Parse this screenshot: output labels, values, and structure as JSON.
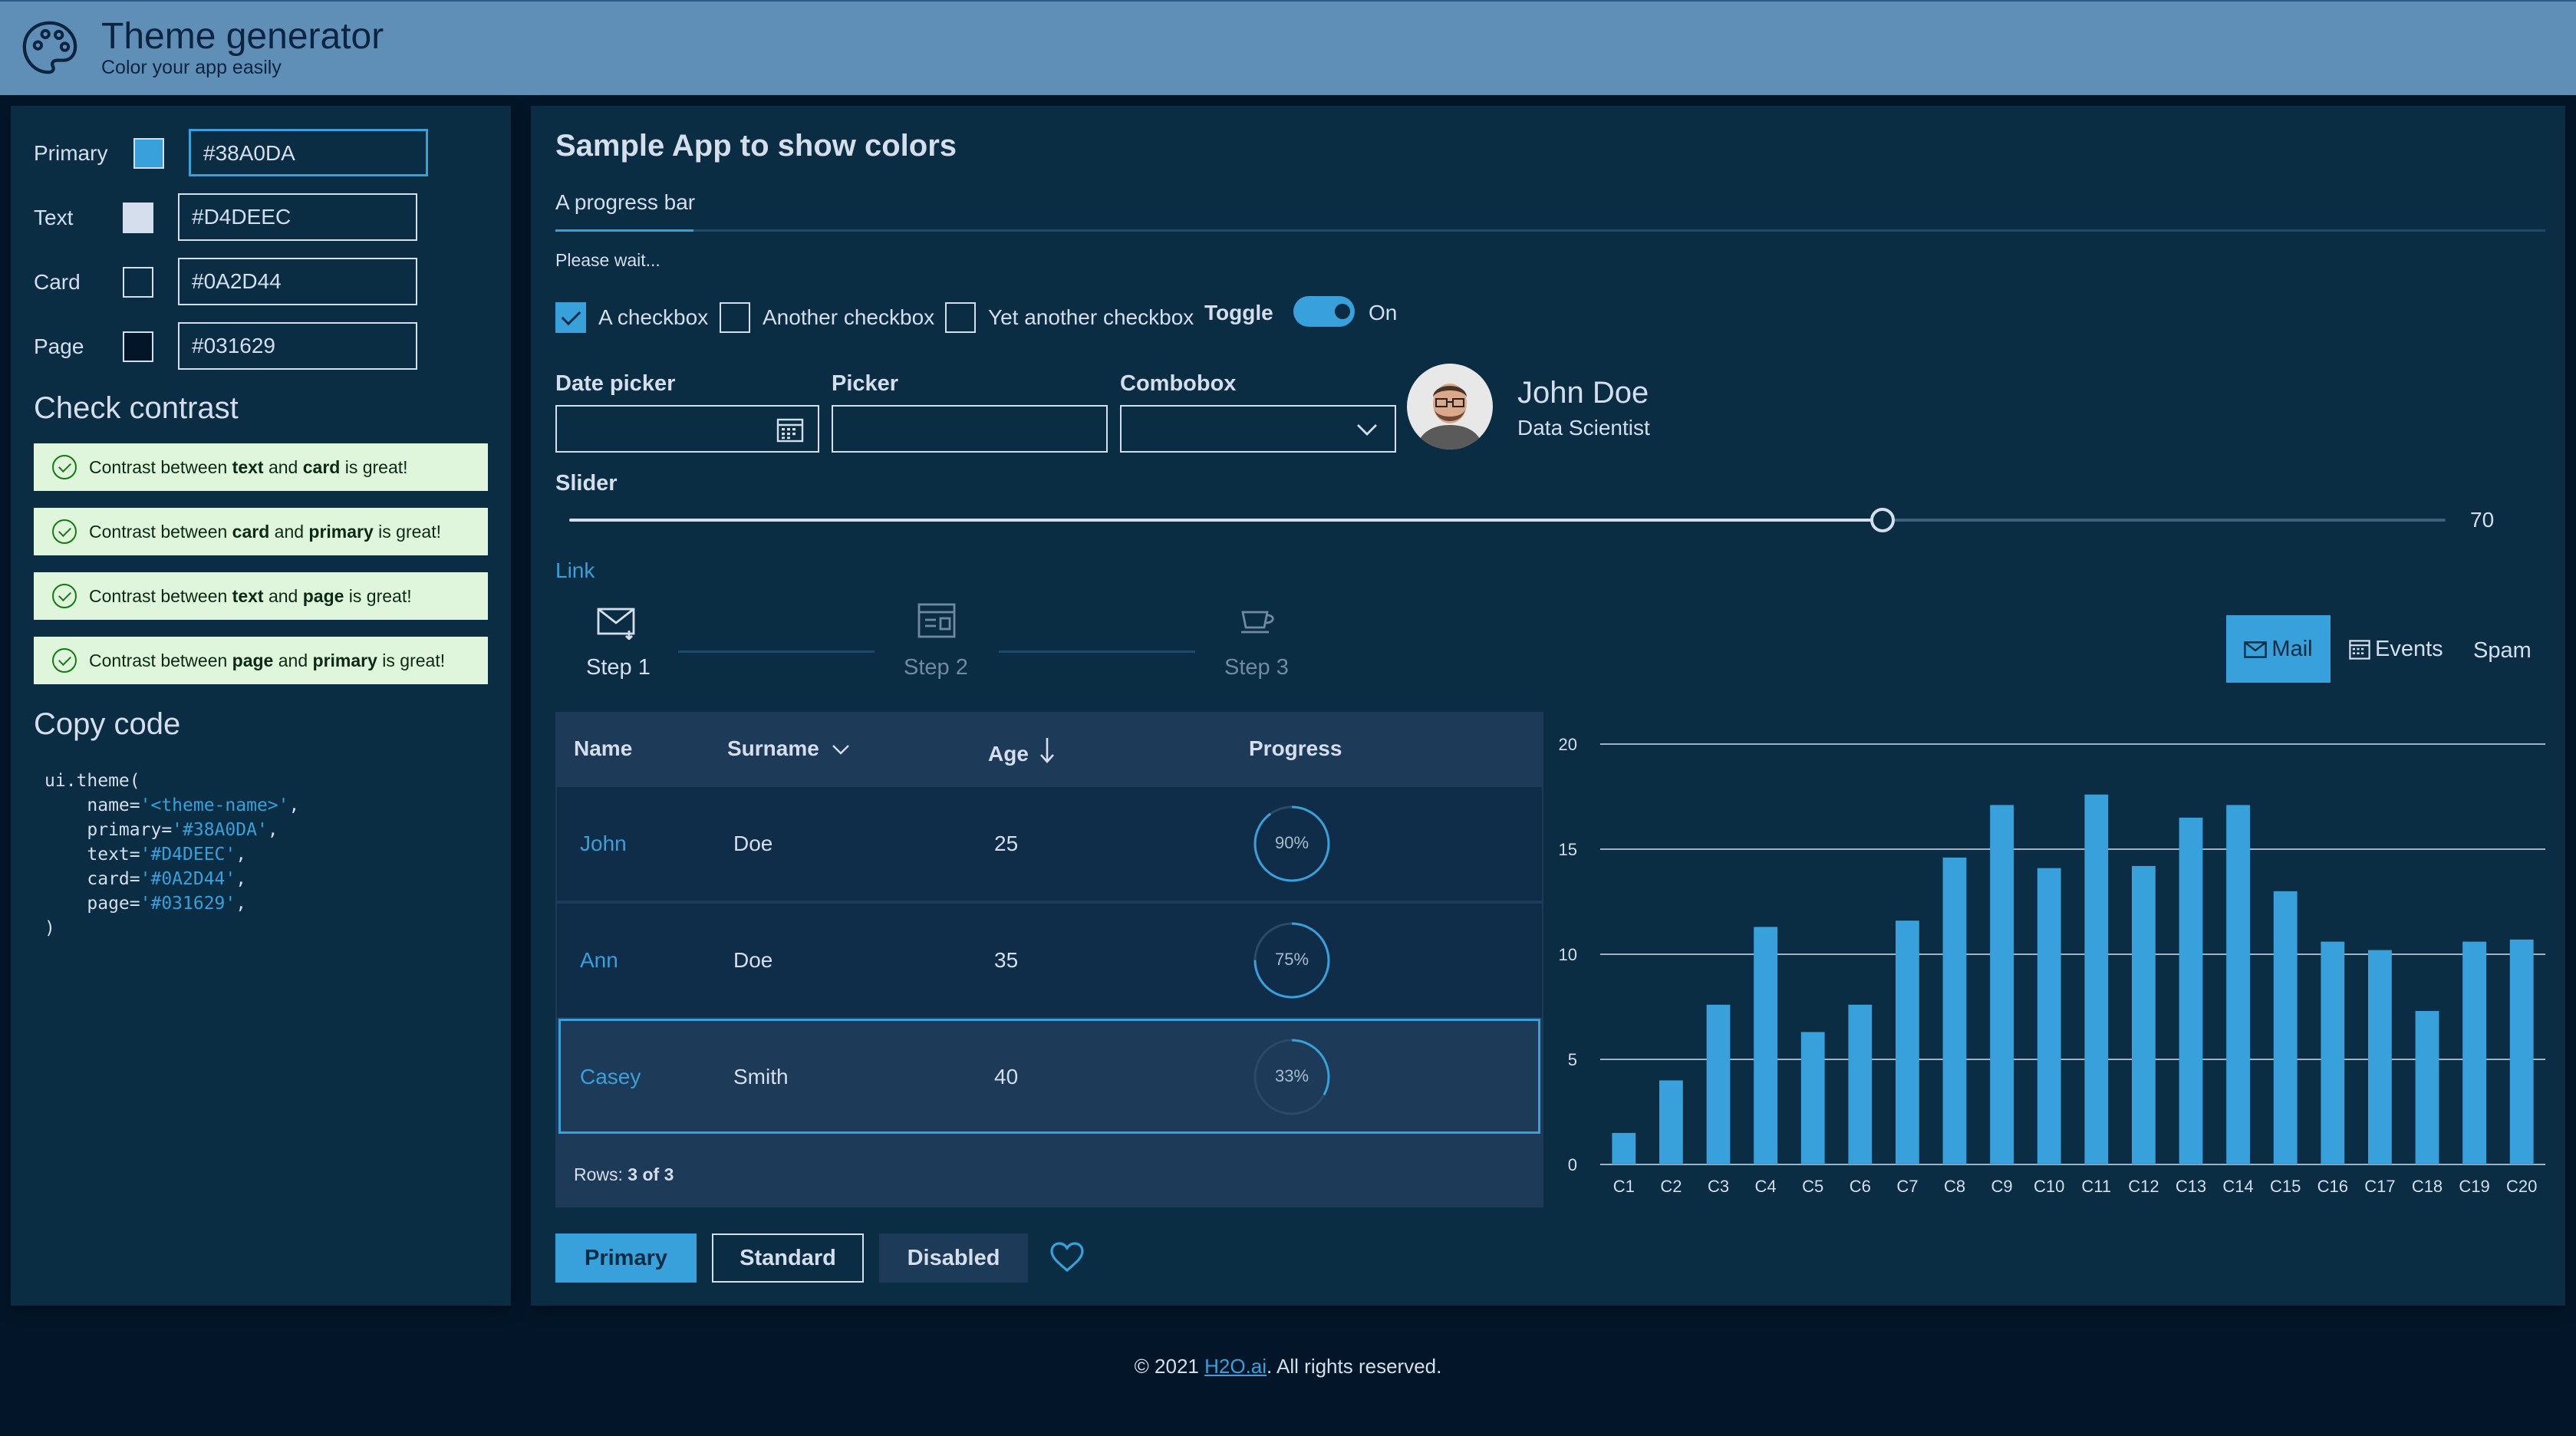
{
  "header": {
    "title": "Theme generator",
    "subtitle": "Color your app easily"
  },
  "theme_form": {
    "fields": [
      {
        "label": "Primary",
        "value": "#38A0DA",
        "swatch": "#38A0DA"
      },
      {
        "label": "Text",
        "value": "#D4DEEC",
        "swatch": "#D4DEEC"
      },
      {
        "label": "Card",
        "value": "#0A2D44",
        "swatch": "#0A2D44"
      },
      {
        "label": "Page",
        "value": "#031629",
        "swatch": "#031629"
      }
    ]
  },
  "contrast": {
    "title": "Check contrast",
    "messages": [
      {
        "pre": "Contrast between ",
        "a": "text",
        "mid": " and ",
        "b": "card",
        "post": " is great!"
      },
      {
        "pre": "Contrast between ",
        "a": "card",
        "mid": " and ",
        "b": "primary",
        "post": " is great!"
      },
      {
        "pre": "Contrast between ",
        "a": "text",
        "mid": " and ",
        "b": "page",
        "post": " is great!"
      },
      {
        "pre": "Contrast between ",
        "a": "page",
        "mid": " and ",
        "b": "primary",
        "post": " is great!"
      }
    ]
  },
  "copy_code": {
    "title": "Copy code",
    "open": "ui.theme(",
    "lines": [
      {
        "key": "    name=",
        "val": "'<theme-name>'",
        "end": ","
      },
      {
        "key": "    primary=",
        "val": "'#38A0DA'",
        "end": ","
      },
      {
        "key": "    text=",
        "val": "'#D4DEEC'",
        "end": ","
      },
      {
        "key": "    card=",
        "val": "'#0A2D44'",
        "end": ","
      },
      {
        "key": "    page=",
        "val": "'#031629'",
        "end": ","
      }
    ],
    "close": ")"
  },
  "main": {
    "title": "Sample App to show colors",
    "progress_label": "A progress bar",
    "progress_caption": "Please wait...",
    "checkboxes": [
      {
        "label": "A checkbox",
        "checked": true
      },
      {
        "label": "Another checkbox",
        "checked": false
      },
      {
        "label": "Yet another checkbox",
        "checked": false
      }
    ],
    "toggle": {
      "label": "Toggle",
      "state": "On"
    },
    "date_picker_label": "Date picker",
    "picker_label": "Picker",
    "combobox_label": "Combobox",
    "persona": {
      "name": "John Doe",
      "role": "Data Scientist"
    },
    "slider": {
      "label": "Slider",
      "value": 70,
      "min": 0,
      "max": 100
    },
    "link": "Link",
    "steps": [
      {
        "label": "Step 1",
        "icon": "mail-icon",
        "active": true
      },
      {
        "label": "Step 2",
        "icon": "calendar-icon",
        "active": false
      },
      {
        "label": "Step 3",
        "icon": "cup-icon",
        "active": false
      }
    ],
    "tabs": [
      {
        "label": "Mail",
        "icon": "mail-icon",
        "selected": true
      },
      {
        "label": "Events",
        "icon": "calendar-icon",
        "selected": false
      },
      {
        "label": "Spam",
        "selected": false
      }
    ]
  },
  "table": {
    "columns": [
      "Name",
      "Surname",
      "Age",
      "Progress"
    ],
    "rows": [
      {
        "name": "John",
        "surname": "Doe",
        "age": "25",
        "progress": "90%",
        "progress_value": 0.9
      },
      {
        "name": "Ann",
        "surname": "Doe",
        "age": "35",
        "progress": "75%",
        "progress_value": 0.75
      },
      {
        "name": "Casey",
        "surname": "Smith",
        "age": "40",
        "progress": "33%",
        "progress_value": 0.33
      }
    ],
    "rows_label": "Rows: ",
    "rows_count": "3 of 3"
  },
  "buttons": {
    "primary": "Primary",
    "standard": "Standard",
    "disabled": "Disabled"
  },
  "chart_data": {
    "type": "bar",
    "categories": [
      "C1",
      "C2",
      "C3",
      "C4",
      "C5",
      "C6",
      "C7",
      "C8",
      "C9",
      "C10",
      "C11",
      "C12",
      "C13",
      "C14",
      "C15",
      "C16",
      "C17",
      "C18",
      "C19",
      "C20"
    ],
    "values": [
      1.5,
      4,
      7.6,
      11.3,
      6.3,
      7.6,
      11.6,
      14.6,
      17.1,
      14.1,
      17.6,
      14.2,
      16.5,
      17.1,
      13,
      10.6,
      10.2,
      7.3,
      10.6,
      10.7
    ],
    "ylim": [
      0,
      20
    ],
    "yticks": [
      0,
      5,
      10,
      15,
      20
    ],
    "grid": true,
    "color": "#38A0DA"
  },
  "footer": {
    "prefix": "© 2021 ",
    "link": "H2O.ai",
    "suffix": ". All rights reserved."
  }
}
